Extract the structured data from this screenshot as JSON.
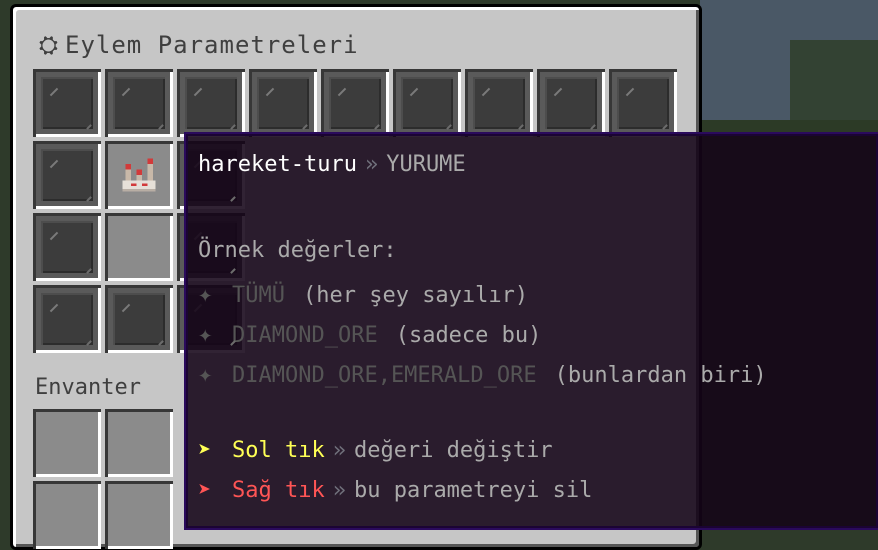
{
  "gui": {
    "title": "Eylem Parametreleri",
    "title_icon": "gear-icon",
    "inventory_label": "Envanter"
  },
  "tooltip": {
    "key": "hareket-turu",
    "separator": "»",
    "value": "YURUME",
    "examples_heading": "Örnek değerler:",
    "examples": [
      {
        "value": "TÜMÜ",
        "note": "(her şey sayılır)"
      },
      {
        "value": "DIAMOND_ORE",
        "note": "(sadece bu)"
      },
      {
        "value": "DIAMOND_ORE,EMERALD_ORE",
        "note": "(bunlardan biri)"
      }
    ],
    "left_click": {
      "label": "Sol tık",
      "action": "değeri değiştir"
    },
    "right_click": {
      "label": "Sağ tık",
      "action": "bu parametreyi sil"
    }
  },
  "colors": {
    "tooltip_bg": "#140418",
    "tooltip_border": "#2a0a5c",
    "left_click": "#ffff55",
    "right_click": "#ff5555",
    "example_text": "#555555",
    "note_text": "#aaaaaa"
  }
}
